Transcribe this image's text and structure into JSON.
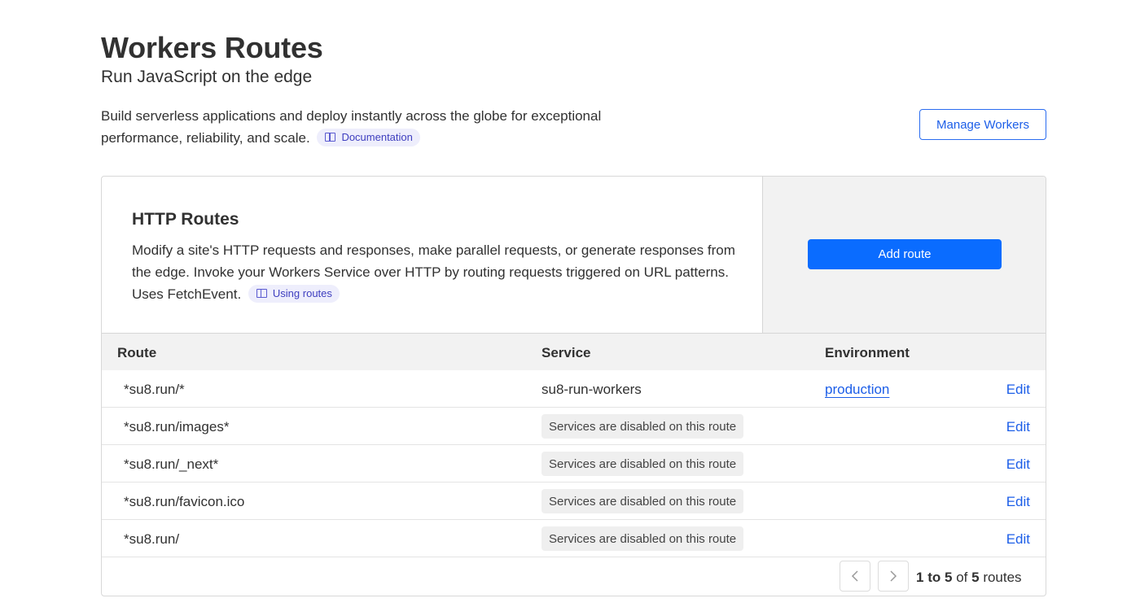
{
  "header": {
    "title": "Workers Routes",
    "subtitle": "Run JavaScript on the edge",
    "description": "Build serverless applications and deploy instantly across the globe for exceptional performance, reliability, and scale.",
    "doc_link": "Documentation",
    "manage_button": "Manage Workers"
  },
  "http_routes": {
    "title": "HTTP Routes",
    "description": "Modify a site's HTTP requests and responses, make parallel requests, or generate responses from the edge. Invoke your Workers Service over HTTP by routing requests triggered on URL patterns. Uses FetchEvent.",
    "doc_link": "Using routes",
    "add_button": "Add route"
  },
  "table": {
    "columns": [
      "Route",
      "Service",
      "Environment"
    ],
    "rows": [
      {
        "route": "*su8.run/*",
        "service": "su8-run-workers",
        "environment": "production",
        "action": "Edit"
      },
      {
        "route": "*su8.run/images*",
        "service": "Services are disabled on this route",
        "environment": "",
        "action": "Edit"
      },
      {
        "route": "*su8.run/_next*",
        "service": "Services are disabled on this route",
        "environment": "",
        "action": "Edit"
      },
      {
        "route": "*su8.run/favicon.ico",
        "service": "Services are disabled on this route",
        "environment": "",
        "action": "Edit"
      },
      {
        "route": "*su8.run/",
        "service": "Services are disabled on this route",
        "environment": "",
        "action": "Edit"
      }
    ]
  },
  "pagination": {
    "start": "1",
    "to": "to",
    "end": "5",
    "of": "of",
    "total": "5",
    "unit": "routes",
    "prev_icon": "chevron-left-icon",
    "next_icon": "chevron-right-icon"
  },
  "colors": {
    "accent": "#0a6cff",
    "link": "#1c5ee8",
    "doc_pill_bg": "#eeeefc"
  }
}
